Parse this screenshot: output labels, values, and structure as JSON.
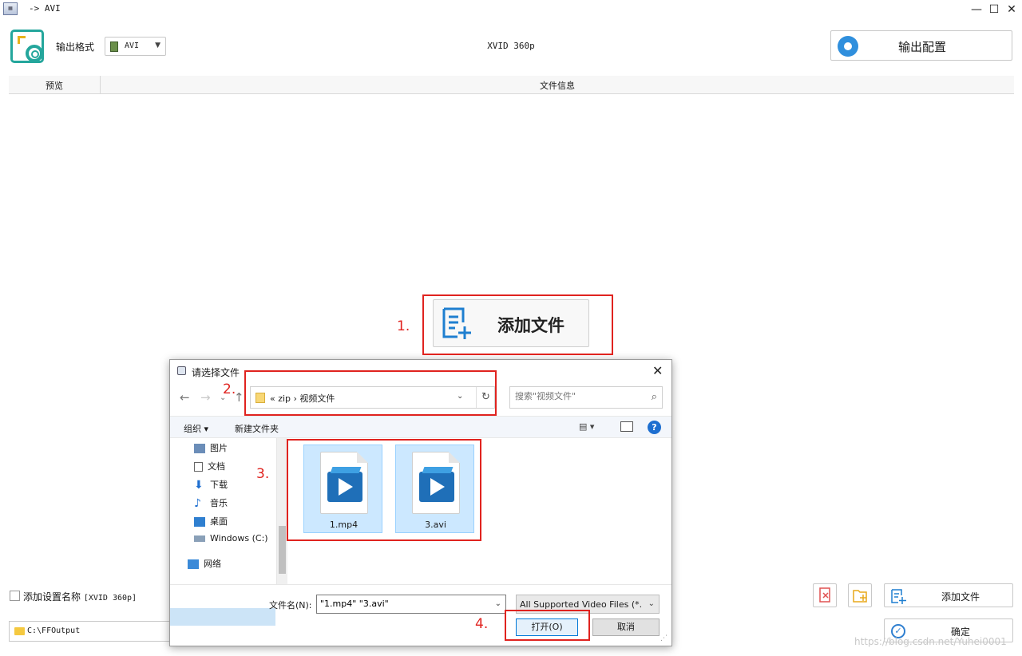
{
  "window": {
    "title": "-> AVI",
    "min": "—",
    "max": "☐",
    "close": "✕"
  },
  "toolbar": {
    "format_label": "输出格式",
    "format_value": "AVI",
    "preset": "XVID 360p",
    "output_config_label": "输出配置"
  },
  "list": {
    "col_preview": "预览",
    "col_info": "文件信息"
  },
  "center": {
    "add_file_label": "添加文件"
  },
  "steps": [
    "1.",
    "2.",
    "3.",
    "4."
  ],
  "bottom": {
    "save_preset_label": "添加设置名称",
    "save_preset_value": "[XVID 360p]",
    "output_path": "C:\\FFOutput",
    "add_file_label": "添加文件",
    "confirm_label": "确定"
  },
  "dialog": {
    "title": "请选择文件",
    "breadcrumb": "«  zip  ›  视频文件",
    "search_placeholder": "搜索\"视频文件\"",
    "organize": "组织 ▾",
    "new_folder": "新建文件夹",
    "help": "?",
    "nav": [
      "图片",
      "文档",
      "下载",
      "音乐",
      "桌面",
      "Windows (C:)",
      "网络"
    ],
    "files": [
      "1.mp4",
      "3.avi"
    ],
    "filename_label": "文件名(N):",
    "filename_value": "\"1.mp4\" \"3.avi\"",
    "filetype": "All Supported Video Files (*.",
    "open_label": "打开(O)",
    "cancel_label": "取消"
  },
  "watermark": "https://blog.csdn.net/Yuhei0001",
  "colors": {
    "accent": "#24a69c",
    "highlight_red": "#e0231f",
    "selection": "#cce8ff",
    "primary_blue": "#0078d7"
  }
}
